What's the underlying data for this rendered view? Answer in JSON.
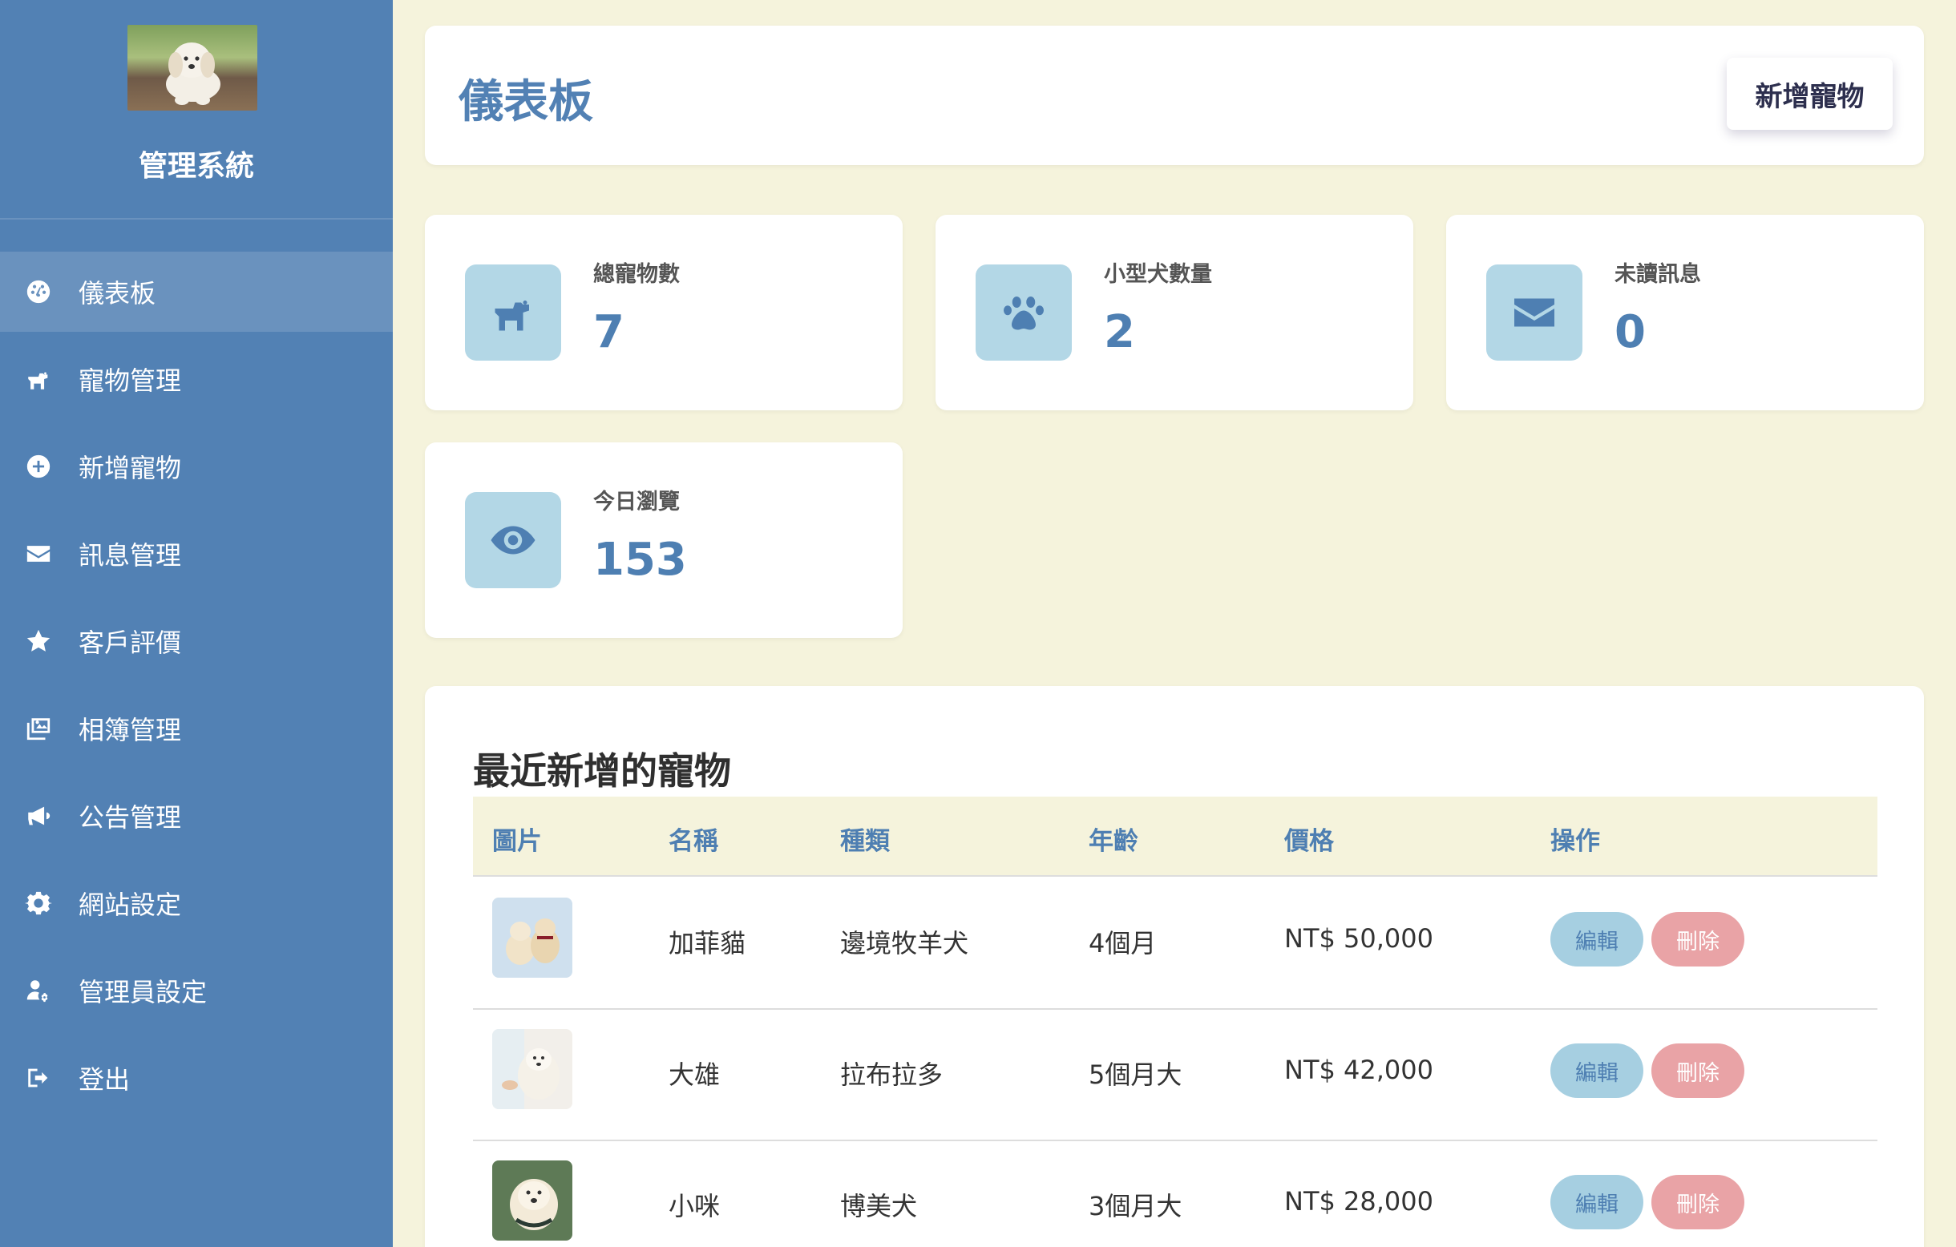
{
  "sidebar": {
    "brand": "管理系統",
    "items": [
      {
        "label": "儀表板",
        "icon": "dashboard-gauge-icon"
      },
      {
        "label": "寵物管理",
        "icon": "dog-icon"
      },
      {
        "label": "新增寵物",
        "icon": "plus-circle-icon"
      },
      {
        "label": "訊息管理",
        "icon": "envelope-icon"
      },
      {
        "label": "客戶評價",
        "icon": "star-icon"
      },
      {
        "label": "相簿管理",
        "icon": "images-icon"
      },
      {
        "label": "公告管理",
        "icon": "bullhorn-icon"
      },
      {
        "label": "網站設定",
        "icon": "gear-icon"
      },
      {
        "label": "管理員設定",
        "icon": "user-gear-icon"
      },
      {
        "label": "登出",
        "icon": "sign-out-icon"
      }
    ],
    "active_index": 0
  },
  "header": {
    "title": "儀表板",
    "add_button": "新增寵物"
  },
  "stats": [
    {
      "label": "總寵物數",
      "value": "7",
      "icon": "dog-icon"
    },
    {
      "label": "小型犬數量",
      "value": "2",
      "icon": "paw-icon"
    },
    {
      "label": "未讀訊息",
      "value": "0",
      "icon": "envelope-icon"
    },
    {
      "label": "今日瀏覽",
      "value": "153",
      "icon": "eye-icon"
    }
  ],
  "recent": {
    "title": "最近新增的寵物",
    "columns": [
      "圖片",
      "名稱",
      "種類",
      "年齡",
      "價格",
      "操作"
    ],
    "rows": [
      {
        "name": "加菲貓",
        "breed": "邊境牧羊犬",
        "age": "4個月",
        "price": "NT$ 50,000"
      },
      {
        "name": "大雄",
        "breed": "拉布拉多",
        "age": "5個月大",
        "price": "NT$ 42,000"
      },
      {
        "name": "小咪",
        "breed": "博美犬",
        "age": "3個月大",
        "price": "NT$ 28,000"
      }
    ],
    "edit_label": "編輯",
    "delete_label": "刪除"
  },
  "colors": {
    "sidebar": "#5281b4",
    "background": "#f5f3dc",
    "accent": "#4e7fb2",
    "icon_tile": "#b3d7e6",
    "delete": "#e9a3a6"
  }
}
